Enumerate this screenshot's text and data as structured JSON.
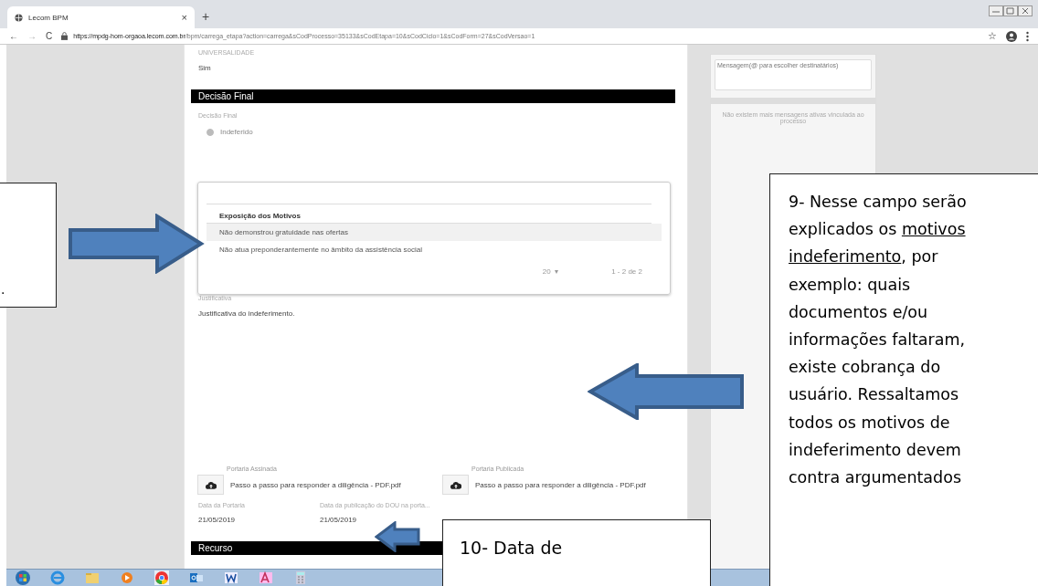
{
  "browser": {
    "back": "←",
    "forward": "→",
    "reload": "C",
    "bookmark": "☆",
    "tab_title": "Lecom BPM",
    "tab_close": "×",
    "new_tab": "+",
    "url_host": "https://mpdg-hom-orgaoa.lecom.com.br",
    "url_path": "/bpm/carrega_etapa?action=carrega&sCodProcesso=35133&sCodEtapa=10&sCodCiclo=1&sCodForm=27&sCodVersao=1"
  },
  "form": {
    "top_field": {
      "label": "UNIVERSALIDADE",
      "value": "Sim"
    },
    "section": "Decisão Final",
    "decision": {
      "label": "Decisão Final",
      "option": "Indeferido",
      "selected": true
    },
    "table": {
      "column": "Exposição dos Motivos",
      "rows": [
        {
          "text": "Não demonstrou gratuidade nas ofertas",
          "highlighted": true
        },
        {
          "text": "Não atua preponderantemente no âmbito da assistência social",
          "highlighted": false
        }
      ],
      "page_size": "20",
      "caret": "▾",
      "range": "1 - 2 de 2"
    },
    "justification": {
      "label": "Justificativa",
      "value": "Justificativa do indeferimento."
    },
    "attachments": [
      {
        "label": "Portaria Assinada",
        "file": "Passo a passo para responder a diligência - PDF.pdf"
      },
      {
        "label": "Portaria Publicada",
        "file": "Passo a passo para responder a diligência - PDF.pdf"
      }
    ],
    "dates": [
      {
        "label": "Data da Portaria",
        "value": "21/05/2019"
      },
      {
        "label": "Data da publicação do DOU na porta...",
        "value": "21/05/2019"
      }
    ],
    "next_section": "Recurso"
  },
  "messages": {
    "placeholder": "Mensagem(@ para escolher destinatários)",
    "empty": "Não existem mais mensagens ativas vinculada ao processo"
  },
  "callouts": [
    {
      "kind": "left",
      "lines": [
        [
          {
            "text": ".",
            "underline": false
          }
        ]
      ]
    },
    {
      "kind": "right",
      "lines": [
        [
          {
            "text": "9- Nesse campo serão",
            "underline": false
          }
        ],
        [
          {
            "text": "explicados os ",
            "underline": false
          },
          {
            "text": "motivos",
            "underline": true
          }
        ],
        [
          {
            "text": "indeferimento",
            "underline": true
          },
          {
            "text": ", por",
            "underline": false
          }
        ],
        [
          {
            "text": "exemplo: quais",
            "underline": false
          }
        ],
        [
          {
            "text": "documentos e/ou",
            "underline": false
          }
        ],
        [
          {
            "text": "informações faltaram,",
            "underline": false
          }
        ],
        [
          {
            "text": "existe cobrança do",
            "underline": false
          }
        ],
        [
          {
            "text": "usuário. Ressaltamos",
            "underline": false
          }
        ],
        [
          {
            "text": "todos os motivos de",
            "underline": false
          }
        ],
        [
          {
            "text": "indeferimento devem",
            "underline": false
          }
        ],
        [
          {
            "text": "contra argumentados",
            "underline": false
          }
        ]
      ]
    },
    {
      "kind": "bottom",
      "lines": [
        [
          {
            "text": "10- Data de",
            "underline": false
          }
        ]
      ]
    }
  ]
}
